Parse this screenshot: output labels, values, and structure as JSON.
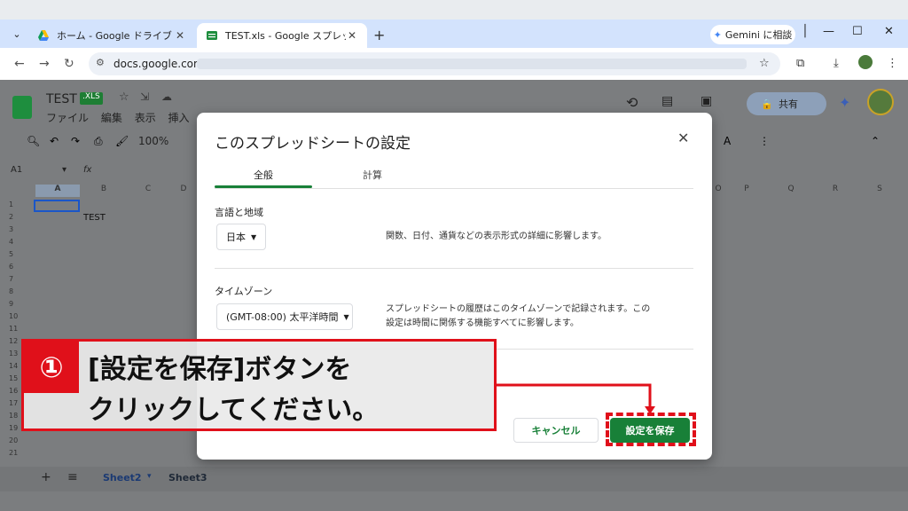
{
  "browser": {
    "tabs": [
      {
        "label": "ホーム - Google ドライブ",
        "icon": "google-drive-icon",
        "close": "✕"
      },
      {
        "label": "TEST.xls - Google スプレッドシート",
        "icon": "google-sheets-icon",
        "close": "✕"
      }
    ],
    "new_tab": "+",
    "gemini_label": "Gemini に相談",
    "url": "docs.google.com/"
  },
  "sheets": {
    "title": "TEST",
    "badge": ".XLS",
    "menu": [
      "ファイル",
      "編集",
      "表示",
      "挿入"
    ],
    "zoom": "100%",
    "share_label": "共有",
    "name_box": "A1",
    "fx": "fx",
    "col_left": [
      "A",
      "B",
      "C",
      "D"
    ],
    "col_right": [
      "P",
      "Q",
      "R",
      "S"
    ],
    "col_right_o": "O",
    "rows": [
      "1",
      "2",
      "3",
      "4",
      "5",
      "6",
      "7",
      "8",
      "9",
      "10",
      "11",
      "12",
      "13",
      "14",
      "15",
      "16",
      "17",
      "18",
      "19",
      "20",
      "21"
    ],
    "cell_b2": "TEST",
    "sheet_tabs": [
      "Sheet2",
      "Sheet3"
    ]
  },
  "dialog": {
    "title": "このスプレッドシートの設定",
    "close": "✕",
    "tab_general": "全般",
    "tab_calc": "計算",
    "locale_label": "言語と地域",
    "locale_value": "日本",
    "locale_desc": "関数、日付、通貨などの表示形式の詳細に影響します。",
    "tz_label": "タイムゾーン",
    "tz_value": "(GMT-08:00) 太平洋時間",
    "tz_desc_1": "スプレッドシートの履歴はこのタイムゾーンで記録されます。この",
    "tz_desc_2": "設定は時間に関係する機能すべてに影響します。",
    "cancel": "キャンセル",
    "save": "設定を保存"
  },
  "callout": {
    "number": "①",
    "line1": "[設定を保存]ボタンを",
    "line2": "クリックしてください。"
  },
  "colors": {
    "accent_green": "#188038",
    "annotation_red": "#e0101a"
  }
}
